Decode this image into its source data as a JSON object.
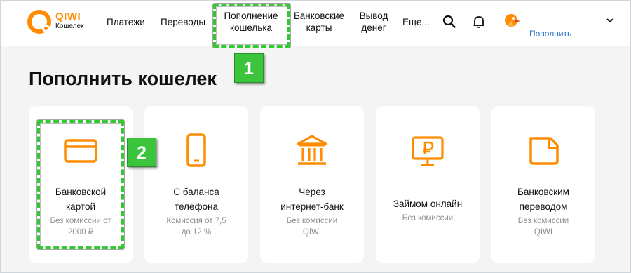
{
  "brand": {
    "name": "QIWI",
    "sub": "Кошелек",
    "accent": "#ff8c00"
  },
  "nav": {
    "payments": "Платежи",
    "transfers": "Переводы",
    "topup_line1": "Пополнение",
    "topup_line2": "кошелька",
    "cards_line1": "Банковские",
    "cards_line2": "карты",
    "withdraw_line1": "Вывод",
    "withdraw_line2": "денег",
    "more": "Еще..."
  },
  "header_right": {
    "search_icon": "search-icon",
    "bell_icon": "bell-icon",
    "avatar_icon": "avatar-icon",
    "topup_link": "Пополнить",
    "chevron_icon": "chevron-down-icon"
  },
  "page": {
    "title": "Пополнить кошелек"
  },
  "cards": [
    {
      "line1": "Банковской",
      "line2": "картой",
      "sub1": "Без комиссии от",
      "sub2": "2000 ₽",
      "icon": "credit-card-icon"
    },
    {
      "line1": "С баланса",
      "line2": "телефона",
      "sub1": "Комиссия от 7,5",
      "sub2": "до 12 %",
      "icon": "phone-icon"
    },
    {
      "line1": "Через",
      "line2": "интернет-банк",
      "sub1": "Без комиссии",
      "sub2": "QIWI",
      "icon": "bank-icon"
    },
    {
      "line1": "Займом онлайн",
      "line2": "",
      "sub1": "Без комиссии",
      "sub2": "",
      "icon": "monitor-ruble-icon"
    },
    {
      "line1": "Банковским",
      "line2": "переводом",
      "sub1": "Без комиссии",
      "sub2": "QIWI",
      "icon": "document-icon"
    }
  ],
  "annotations": {
    "step1": "1",
    "step2": "2",
    "highlight_color": "#33c933"
  }
}
